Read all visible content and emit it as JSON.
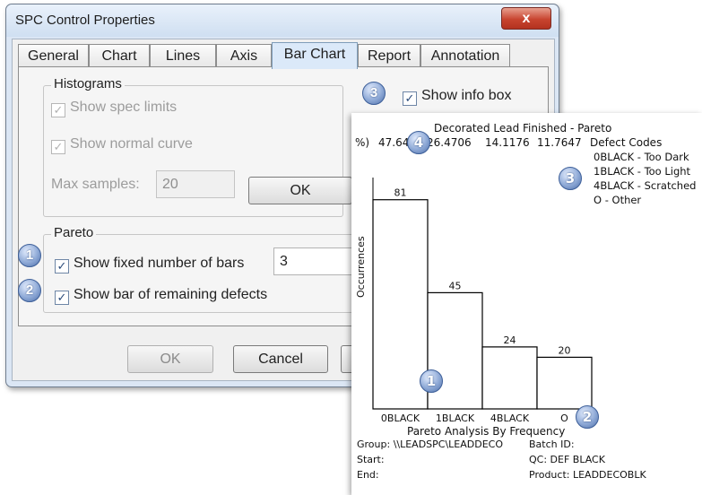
{
  "window": {
    "title": "SPC Control Properties",
    "close_glyph": "x",
    "tabs": [
      "General",
      "Chart",
      "Lines",
      "Axis",
      "Bar Chart",
      "Report",
      "Annotation"
    ],
    "active_tab": "Bar Chart"
  },
  "histograms": {
    "label": "Histograms",
    "show_spec_limits": "Show spec limits",
    "show_normal_curve": "Show normal curve",
    "max_samples_label": "Max samples:",
    "max_samples_value": "20",
    "ok_label": "OK"
  },
  "info_box": {
    "label": "Show info box",
    "checked": true
  },
  "pareto": {
    "label": "Pareto",
    "show_fixed_bars": "Show fixed number of bars",
    "fixed_bars_value": "3",
    "show_remaining": "Show bar of remaining defects"
  },
  "footer": {
    "ok": "OK",
    "cancel": "Cancel"
  },
  "badges": {
    "b1": "1",
    "b2": "2",
    "b3": "3",
    "b4": "4"
  },
  "icons": {
    "check": "check-icon",
    "close": "close-icon"
  },
  "colors": {
    "badge": "#6f8fc6",
    "active_tab": "#dbe9f9"
  },
  "chart_data": {
    "type": "bar",
    "title": "Decorated Lead Finished - Pareto",
    "percent_prefix": "%)",
    "percents": [
      "47.64",
      "26.4706",
      "14.1176",
      "11.7647"
    ],
    "legend_title": "Defect Codes",
    "legend": [
      "0BLACK - Too Dark",
      "1BLACK - Too Light",
      "4BLACK - Scratched",
      "O - Other"
    ],
    "categories": [
      "0BLACK",
      "1BLACK",
      "4BLACK",
      "O"
    ],
    "values": [
      81,
      45,
      24,
      20
    ],
    "ylabel": "Occurrences",
    "xlabel": "Pareto Analysis By Frequency",
    "ylim": [
      0,
      100
    ],
    "info": {
      "group": "Group: \\\\LEADSPC\\LEADDECO",
      "batch": "Batch ID:",
      "start": "Start:",
      "qc": "QC: DEF BLACK",
      "end": "End:",
      "product": "Product: LEADDECOBLK"
    }
  }
}
